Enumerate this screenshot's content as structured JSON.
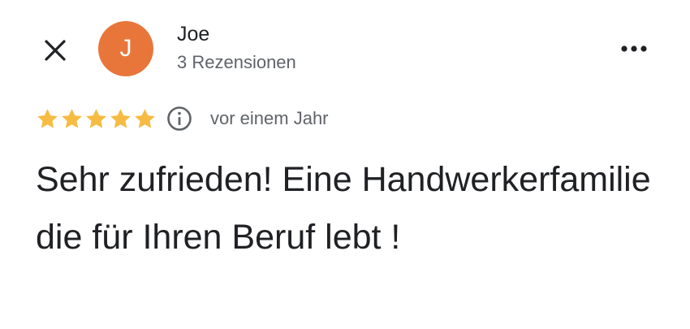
{
  "author": {
    "initial": "J",
    "name": "Joe",
    "review_count": "3 Rezensionen",
    "avatar_color": "#e8763a"
  },
  "header": {
    "close_icon": "close-icon",
    "more_icon": "more-horizontal-icon"
  },
  "rating": {
    "stars": 5,
    "max_stars": 5,
    "star_color": "#f6bb42",
    "info_icon": "info-icon",
    "date": "vor einem Jahr"
  },
  "review": {
    "text": "Sehr zufrieden! Eine Handwerkerfamilie die für Ihren Beruf lebt !"
  }
}
